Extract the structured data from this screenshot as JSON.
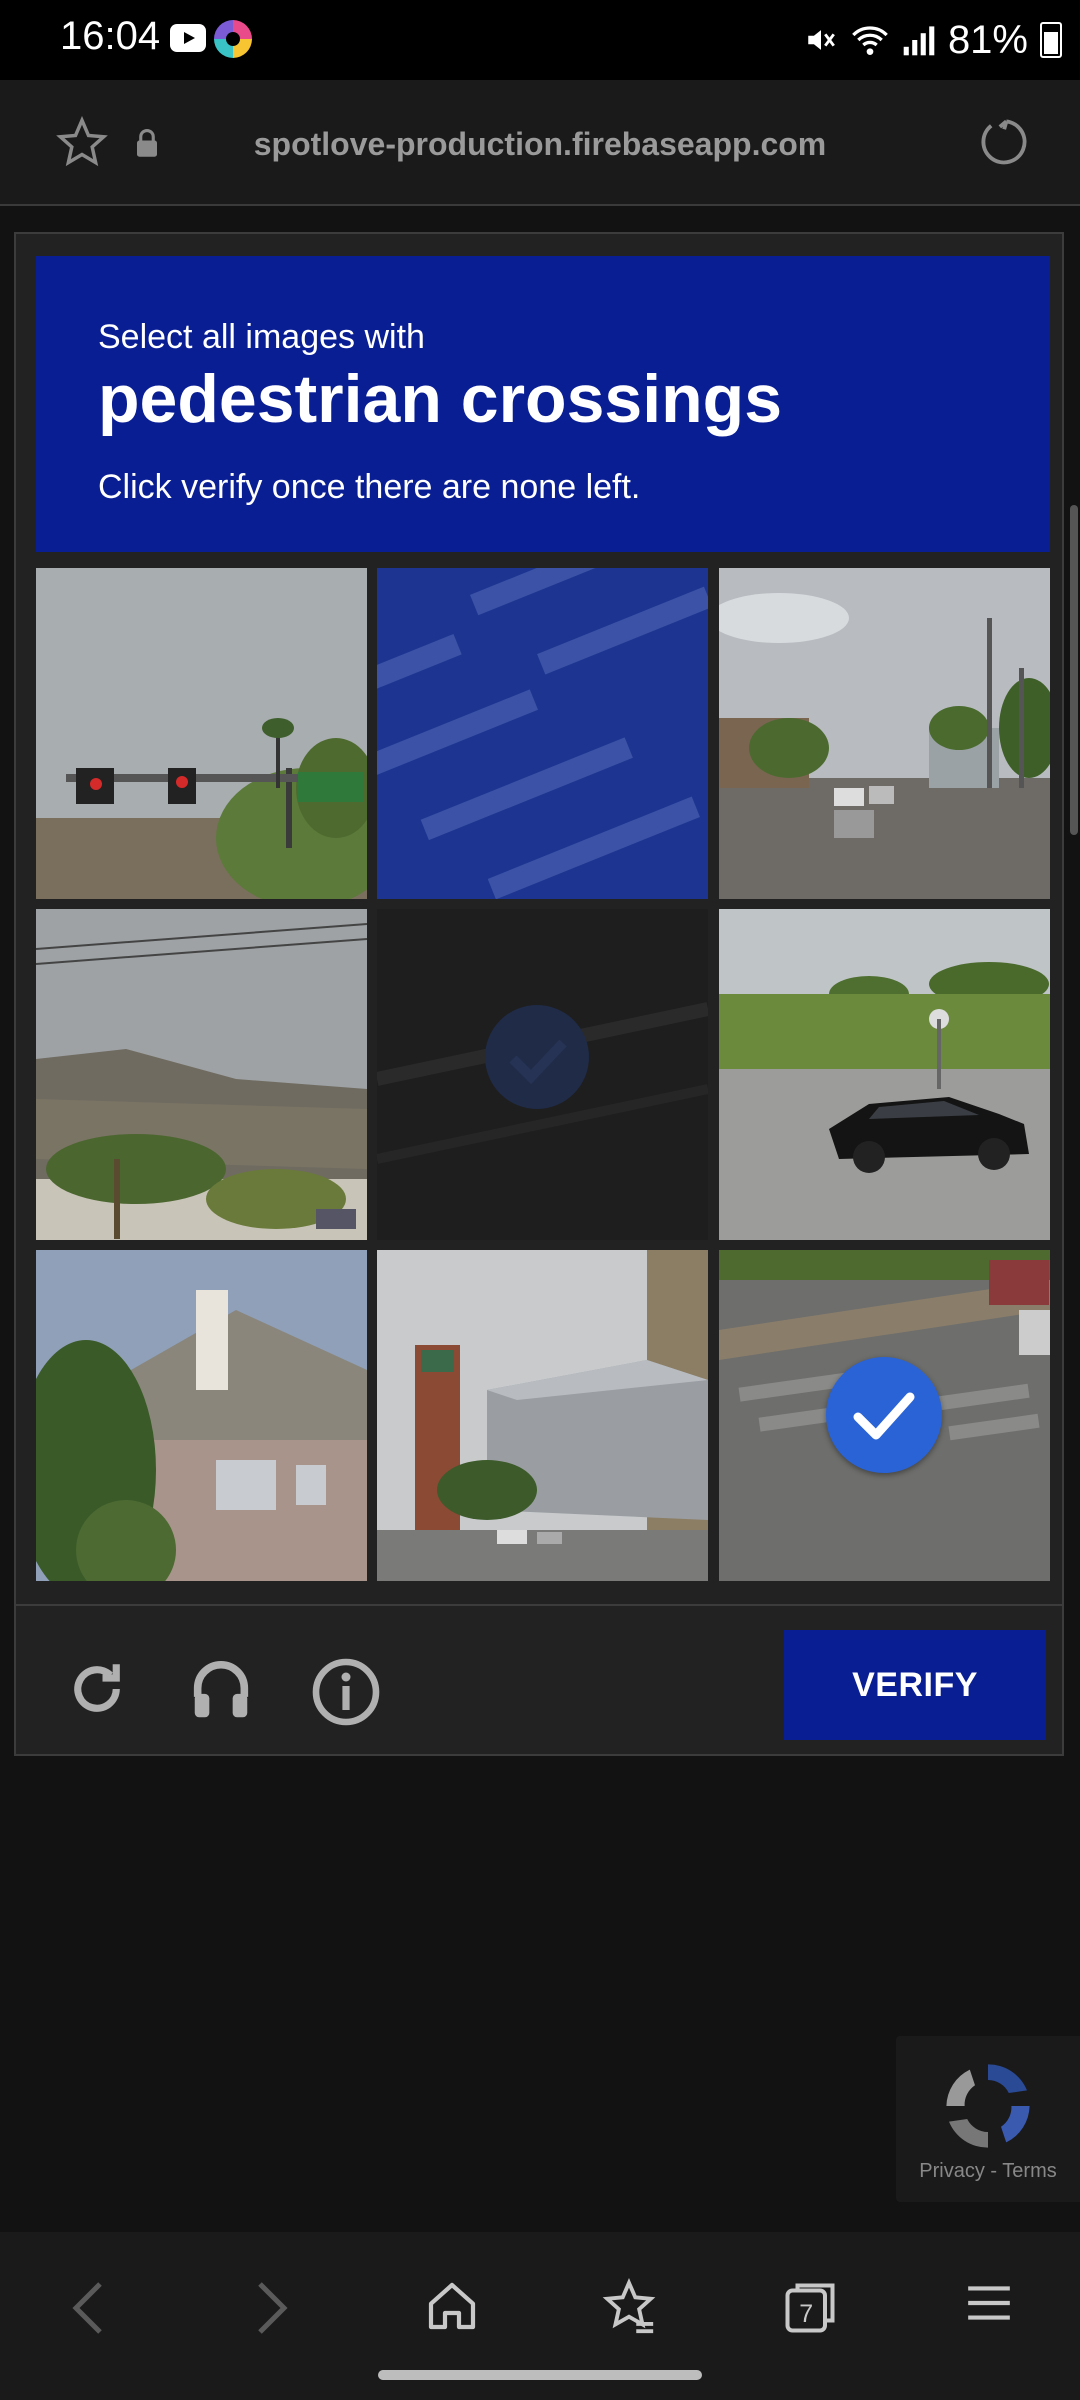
{
  "status_bar": {
    "time": "16:04",
    "battery": "81%"
  },
  "browser": {
    "url": "spotlove-production.firebaseapp.com"
  },
  "challenge": {
    "prompt_prefix": "Select all images with",
    "target": "pedestrian crossings",
    "instruction": "Click verify once there are none left.",
    "verify_label": "VERIFY",
    "tiles": [
      {
        "selected": false
      },
      {
        "selected": false
      },
      {
        "selected": false
      },
      {
        "selected": false
      },
      {
        "selected": true
      },
      {
        "selected": false
      },
      {
        "selected": false
      },
      {
        "selected": false
      },
      {
        "selected": true
      }
    ]
  },
  "recaptcha": {
    "privacy": "Privacy",
    "separator": "-",
    "terms": "Terms"
  },
  "colors": {
    "header_blue": "#0a1e93",
    "check_blue": "#2a63d6"
  }
}
